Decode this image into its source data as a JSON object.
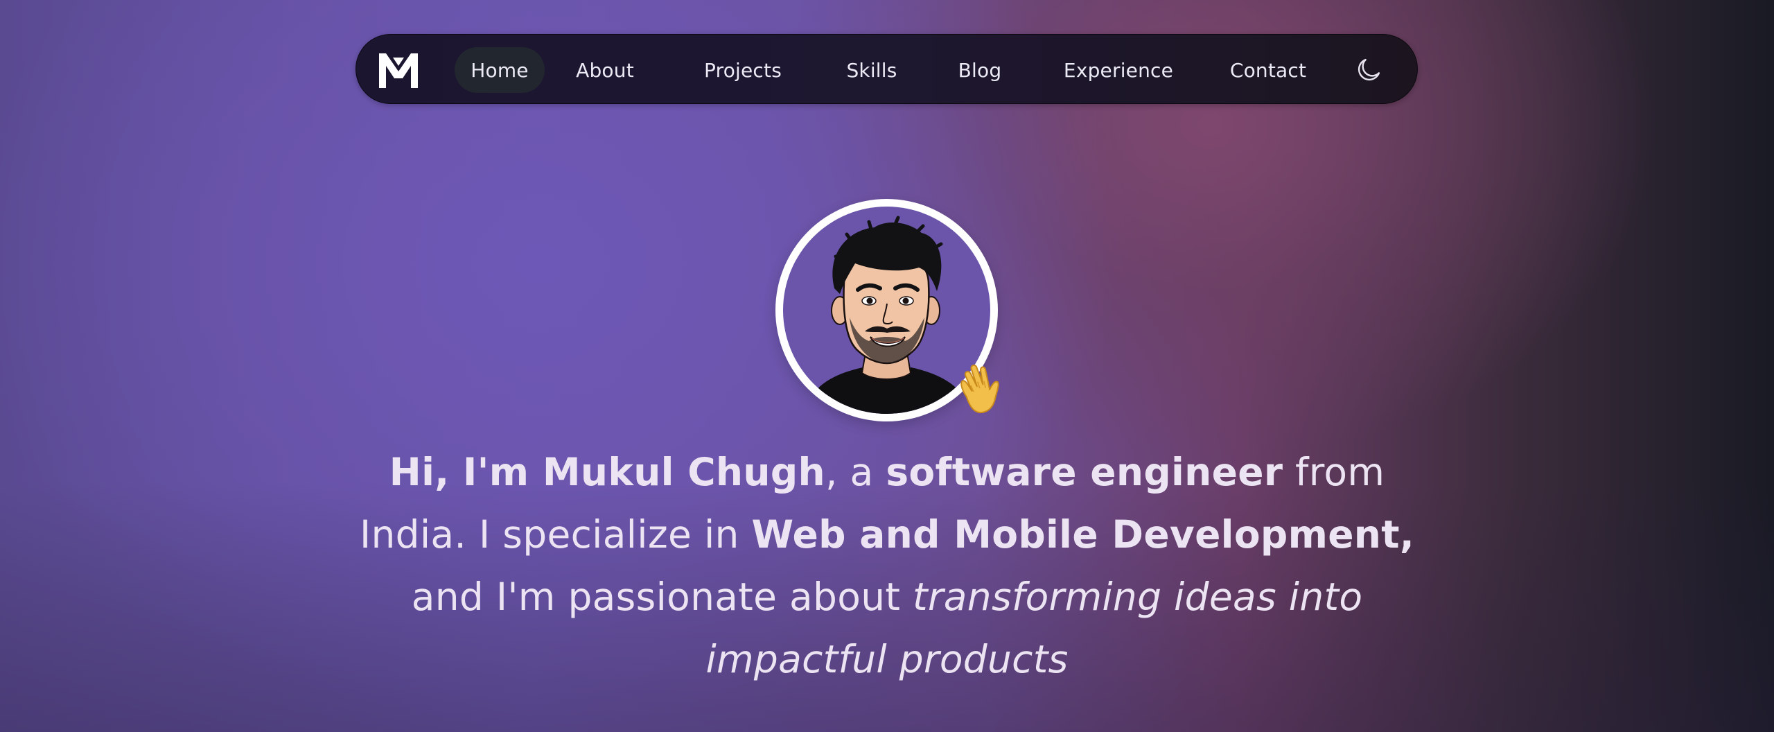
{
  "nav": {
    "logo_icon": "m-logo-icon",
    "items": [
      {
        "label": "Home",
        "active": true
      },
      {
        "label": "About",
        "active": false
      },
      {
        "label": "Projects",
        "active": false
      },
      {
        "label": "Skills",
        "active": false
      },
      {
        "label": "Blog",
        "active": false
      },
      {
        "label": "Experience",
        "active": false
      },
      {
        "label": "Contact",
        "active": false
      }
    ],
    "theme_toggle_icon": "moon-icon"
  },
  "avatar": {
    "icon": "avatar-illustration",
    "badge_icon": "waving-hand-icon"
  },
  "hero": {
    "greeting": "Hi, I'm Mukul Chugh",
    "sep1": ", a ",
    "role": "software engineer",
    "from": " from",
    "country": "India. I specialize in ",
    "specialty": "Web and Mobile Development,",
    "passion_prefix": "and I'm passionate about ",
    "passion_a": "transforming ideas into",
    "passion_b": "impactful products"
  },
  "colors": {
    "accent_purple": "#6a56ac",
    "nav_bg": "#1b1530",
    "active_pill": "#22272f",
    "text": "#ece4f2"
  }
}
